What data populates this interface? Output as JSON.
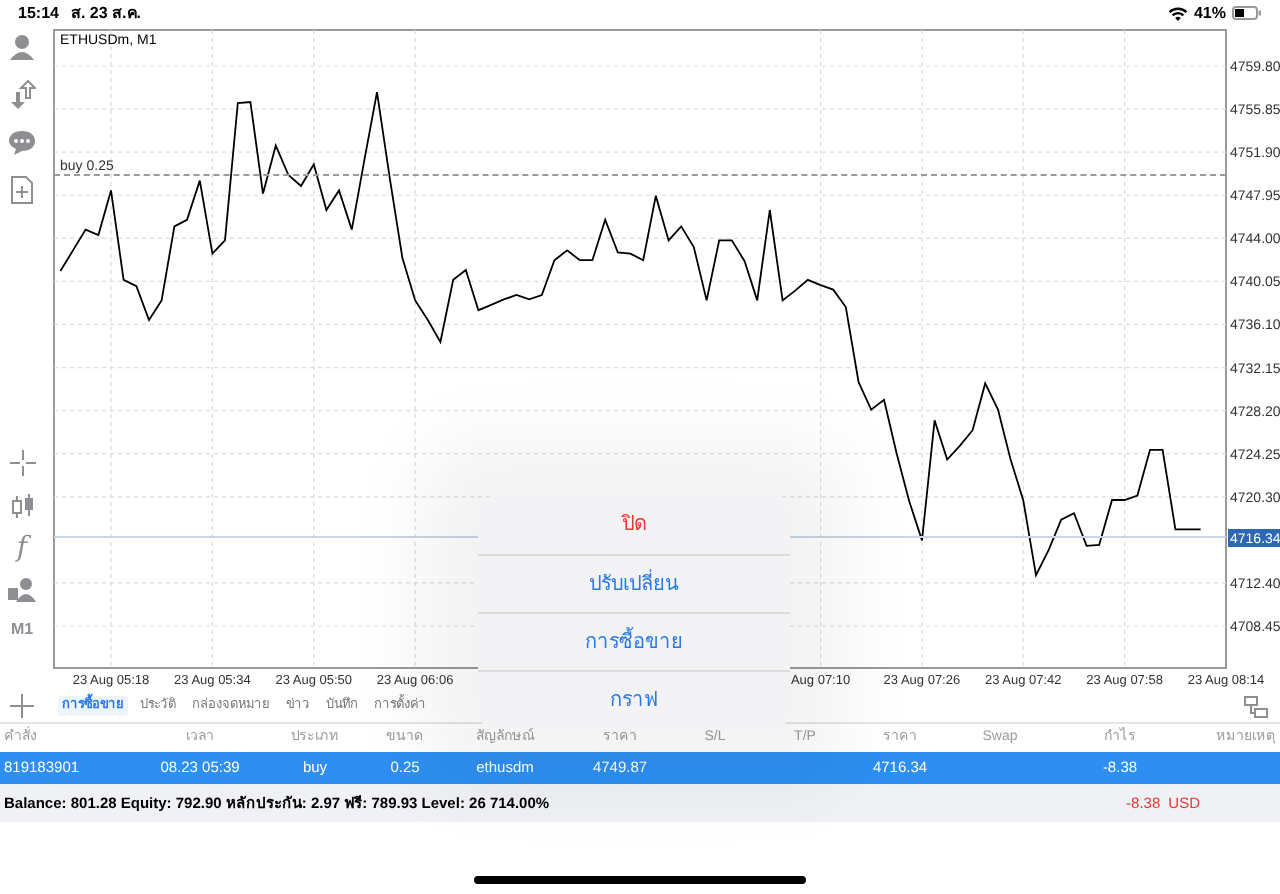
{
  "status_bar": {
    "time": "15:14",
    "date": "ส. 23 ส.ค.",
    "battery": "41%"
  },
  "chart_tools": {
    "function_glyph": "f",
    "timeframe": "M1"
  },
  "chart": {
    "chart_data": {
      "type": "line",
      "title": "ETHUSDm, M1",
      "categories": [
        null,
        null,
        null,
        null,
        "23 Aug 05:18",
        null,
        null,
        null,
        null,
        null,
        null,
        null,
        "23 Aug 05:34",
        null,
        null,
        null,
        null,
        null,
        null,
        null,
        "23 Aug 05:50",
        null,
        null,
        null,
        null,
        null,
        null,
        null,
        "23 Aug 06:06",
        null,
        null,
        null,
        null,
        null,
        null,
        null,
        null,
        null,
        null,
        null,
        null,
        null,
        null,
        null,
        null,
        null,
        null,
        null,
        null,
        null,
        null,
        null,
        null,
        null,
        null,
        null,
        null,
        null,
        null,
        null,
        "Aug 07:10",
        null,
        null,
        null,
        null,
        null,
        null,
        null,
        "23 Aug 07:26",
        null,
        null,
        null,
        null,
        null,
        null,
        null,
        "23 Aug 07:42",
        null,
        null,
        null,
        null,
        null,
        null,
        null,
        "23 Aug 07:58",
        null,
        null,
        null,
        null,
        null,
        null,
        null,
        "23 Aug 08:14"
      ],
      "series": [
        {
          "color": "#000000",
          "values": [
            4741.0,
            4742.9,
            4744.8,
            4744.3,
            4748.4,
            4740.2,
            4739.6,
            4736.5,
            4738.3,
            4745.1,
            4745.7,
            4749.3,
            4742.6,
            4743.8,
            4756.4,
            4756.5,
            4748.1,
            4752.5,
            4749.8,
            4748.8,
            4750.8,
            4746.6,
            4748.4,
            4744.8,
            4751.2,
            4757.4,
            4749.5,
            4742.2,
            4738.3,
            4736.5,
            4734.5,
            4740.2,
            4741.1,
            4737.4,
            4737.9,
            4738.4,
            4738.8,
            4738.4,
            4738.8,
            4742.0,
            4742.9,
            4742.0,
            4742.0,
            4745.7,
            4742.7,
            4742.6,
            4742.0,
            4747.9,
            4743.8,
            4745.1,
            4743.2,
            4738.3,
            4743.8,
            4743.8,
            4741.9,
            4738.3,
            4746.6,
            4738.3,
            4739.2,
            4740.2,
            4739.7,
            4739.3,
            4737.7,
            4730.8,
            4728.3,
            4729.2,
            4724.3,
            4719.9,
            4716.3,
            4727.3,
            4723.7,
            4725.0,
            4726.4,
            4730.7,
            4728.3,
            4723.7,
            4720.0,
            4713.1,
            4715.4,
            4718.2,
            4718.8,
            4715.8,
            4715.9,
            4720.0,
            4720.0,
            4720.4,
            4724.6,
            4724.6,
            4717.3,
            4717.3,
            4717.3,
            null,
            null
          ]
        }
      ],
      "ylim": [
        4704.6,
        4763.1
      ],
      "yticks": [
        {
          "value": 4759.8,
          "label": "4759.80"
        },
        {
          "value": 4755.85,
          "label": "4755.85"
        },
        {
          "value": 4751.9,
          "label": "4751.90"
        },
        {
          "value": 4747.95,
          "label": "4747.95"
        },
        {
          "value": 4744.0,
          "label": "4744.00"
        },
        {
          "value": 4740.05,
          "label": "4740.05"
        },
        {
          "value": 4736.1,
          "label": "4736.10"
        },
        {
          "value": 4732.15,
          "label": "4732.15"
        },
        {
          "value": 4728.2,
          "label": "4728.20"
        },
        {
          "value": 4724.25,
          "label": "4724.25"
        },
        {
          "value": 4720.3,
          "label": "4720.30"
        },
        {
          "value": 4712.4,
          "label": "4712.40"
        },
        {
          "value": 4708.45,
          "label": "4708.45"
        }
      ],
      "grid": true
    },
    "order_line": {
      "label": "buy 0.25"
    },
    "price_tag": "4716.34"
  },
  "tabs": [
    {
      "label": "การซื้อขาย",
      "selected": true
    },
    {
      "label": "ประวัติ",
      "selected": false
    },
    {
      "label": "กล่องจดหมาย",
      "selected": false
    },
    {
      "label": "ข่าว",
      "selected": false
    },
    {
      "label": "บันทึก",
      "selected": false
    },
    {
      "label": "การตั้งค่า",
      "selected": false
    }
  ],
  "table": {
    "columns": [
      "คำสั่ง",
      "เวลา",
      "ประเภท",
      "ขนาด",
      "สัญลักษณ์",
      "ราคา",
      "S/L",
      "T/P",
      "ราคา",
      "Swap",
      "กำไร",
      "หมายเหตุ"
    ],
    "rows": [
      {
        "selected": true,
        "cells": [
          "819183901",
          "08.23 05:39",
          "buy",
          "0.25",
          "ethusdm",
          "4749.87",
          "",
          "",
          "4716.34",
          "",
          "-8.38",
          ""
        ]
      }
    ]
  },
  "summary": {
    "text": "Balance: 801.28 Equity: 792.90 หลักประกัน: 2.97 ฟรี: 789.93 Level: 26 714.00%",
    "profit": "-8.38",
    "currency": "USD"
  },
  "context_menu": {
    "items": [
      {
        "label": "ปิด",
        "kind": "destructive"
      },
      {
        "label": "ปรับเปลี่ยน",
        "kind": "normal"
      },
      {
        "label": "การซื้อขาย",
        "kind": "normal"
      },
      {
        "label": "กราฟ",
        "kind": "normal"
      }
    ]
  }
}
